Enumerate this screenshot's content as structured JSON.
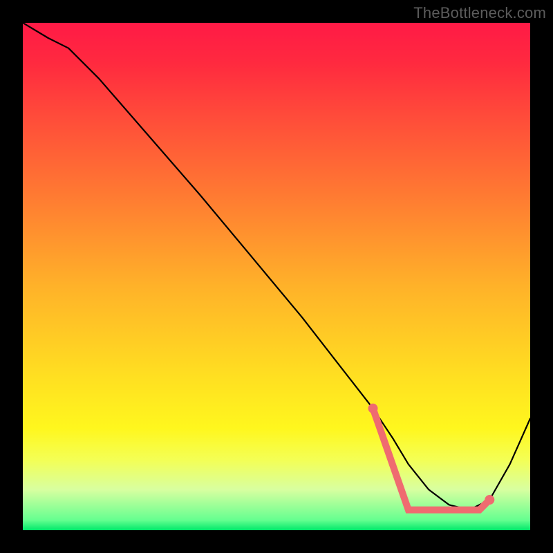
{
  "attribution": "TheBottleneck.com",
  "colors": {
    "background": "#000000",
    "curve": "#000000",
    "markers": "#ef6b70",
    "gradient_top": "#ff1a46",
    "gradient_bottom": "#00e86a"
  },
  "chart_data": {
    "type": "line",
    "title": "",
    "xlabel": "",
    "ylabel": "",
    "xlim": [
      0,
      100
    ],
    "ylim": [
      0,
      100
    ],
    "x": [
      0,
      5,
      9,
      15,
      25,
      35,
      45,
      55,
      62,
      69,
      73,
      76,
      80,
      84,
      88,
      92,
      96,
      100
    ],
    "values": [
      100,
      97,
      95,
      89,
      77.5,
      66,
      54,
      42,
      33,
      24,
      18,
      13,
      8,
      5,
      4,
      6,
      13,
      22
    ],
    "series": [
      {
        "name": "bottleneck-curve",
        "x": [
          0,
          5,
          9,
          15,
          25,
          35,
          45,
          55,
          62,
          69,
          73,
          76,
          80,
          84,
          88,
          92,
          96,
          100
        ],
        "y": [
          100,
          97,
          95,
          89,
          77.5,
          66,
          54,
          42,
          33,
          24,
          18,
          13,
          8,
          5,
          4,
          6,
          13,
          22
        ]
      }
    ],
    "markers": {
      "range_x": [
        69,
        92
      ],
      "range_y": [
        24,
        6
      ],
      "flat_start_x": 76,
      "flat_end_x": 90,
      "flat_y": 4,
      "end_dots": [
        {
          "x": 69,
          "y": 24
        },
        {
          "x": 92,
          "y": 6
        }
      ]
    }
  }
}
